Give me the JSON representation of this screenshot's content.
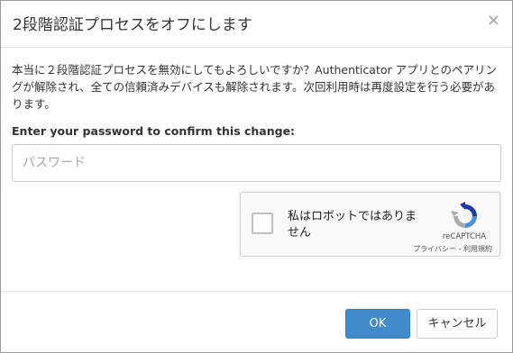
{
  "dialog": {
    "title": "2段階認証プロセスをオフにします",
    "close_label": "×",
    "message": "本当に２段階認証プロセスを無効にしてもよろしいですか？Authenticator アプリとのペアリングが解除され、全ての信頼済みデバイスも解除されます。次回利用時は再度設定を行う必要があります。",
    "password_label": "Enter your password to confirm this change:",
    "password_placeholder": "パスワード",
    "password_value": ""
  },
  "recaptcha": {
    "checkbox_label": "私はロボットではありません",
    "brand": "reCAPTCHA",
    "privacy_link": "プライバシー",
    "separator": " - ",
    "terms_link": "利用規約",
    "checked": false,
    "logo_icon": "recaptcha-logo-icon"
  },
  "footer": {
    "ok_label": "OK",
    "cancel_label": "キャンセル"
  },
  "colors": {
    "primary": "#428bca",
    "border": "#9a9a9a"
  }
}
